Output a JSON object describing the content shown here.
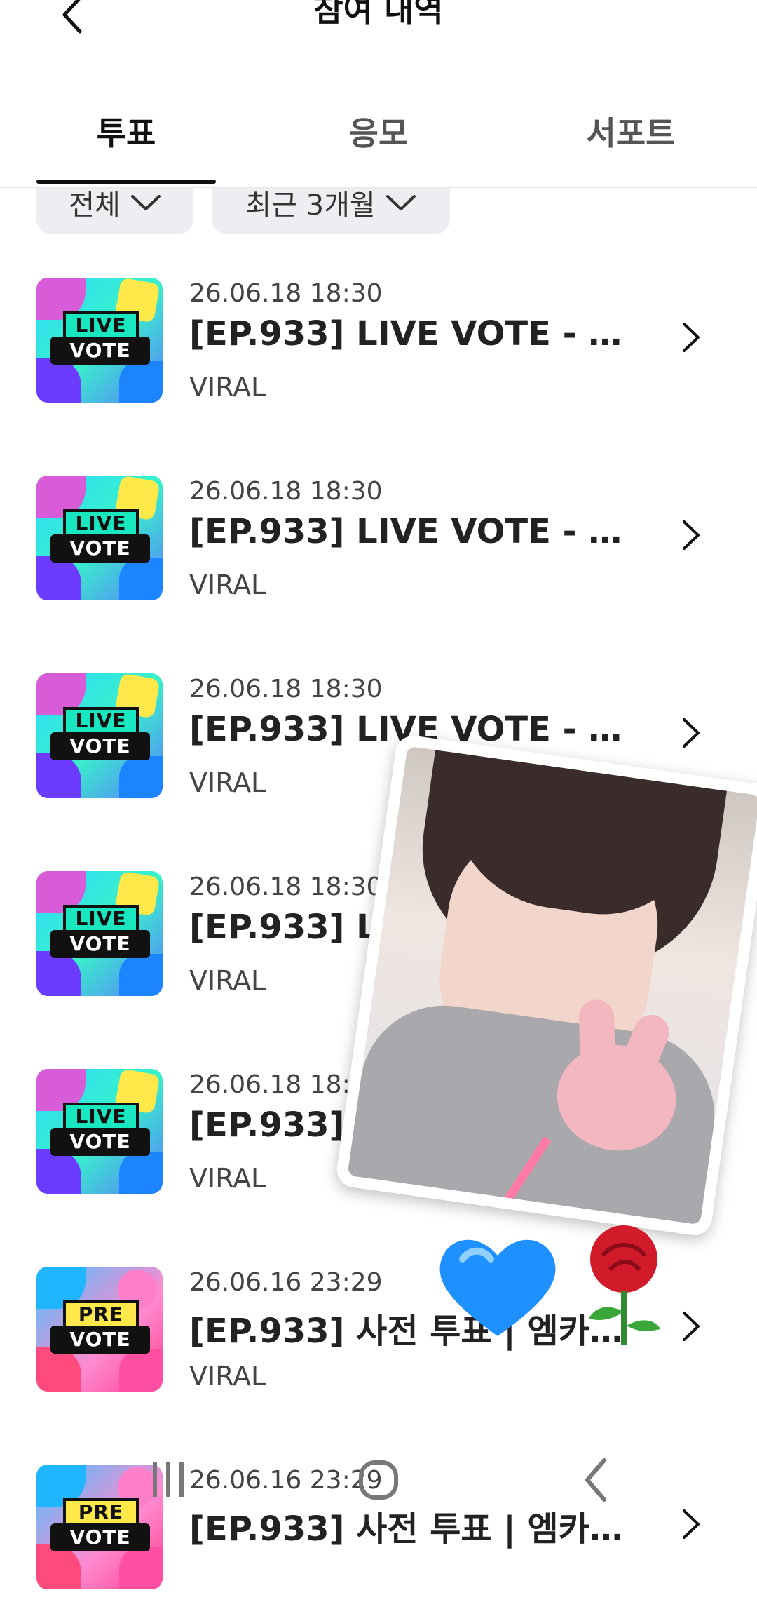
{
  "header": {
    "title": "참여 내역",
    "back_icon": "chevron-left-icon"
  },
  "tabs": [
    {
      "label": "투표",
      "active": true
    },
    {
      "label": "응모",
      "active": false
    },
    {
      "label": "서포트",
      "active": false
    }
  ],
  "filters": [
    {
      "label": "전체"
    },
    {
      "label": "최근 3개월"
    }
  ],
  "items": [
    {
      "date": "26.06.18 18:30",
      "title": "[EP.933] LIVE VOTE - M ...",
      "sub": "VIRAL",
      "thumb": {
        "top": "LIVE",
        "bottom": "VOTE",
        "style": "live"
      }
    },
    {
      "date": "26.06.18 18:30",
      "title": "[EP.933] LIVE VOTE - M ...",
      "sub": "VIRAL",
      "thumb": {
        "top": "LIVE",
        "bottom": "VOTE",
        "style": "live"
      }
    },
    {
      "date": "26.06.18 18:30",
      "title": "[EP.933] LIVE VOTE - M ...",
      "sub": "VIRAL",
      "thumb": {
        "top": "LIVE",
        "bottom": "VOTE",
        "style": "live"
      }
    },
    {
      "date": "26.06.18 18:30",
      "title": "[EP.933] LIVE",
      "sub": "VIRAL",
      "thumb": {
        "top": "LIVE",
        "bottom": "VOTE",
        "style": "live"
      }
    },
    {
      "date": "26.06.18 18:30",
      "title": "[EP.933] L",
      "sub": "VIRAL",
      "thumb": {
        "top": "LIVE",
        "bottom": "VOTE",
        "style": "live"
      }
    },
    {
      "date": "26.06.16 23:29",
      "title": "[EP.933] 사전 투표 | 엠카운...",
      "sub": "VIRAL",
      "thumb": {
        "top": "PRE",
        "bottom": "VOTE",
        "style": "pre"
      }
    },
    {
      "date": "26.06.16 23:29",
      "title": "[EP.933] 사전 투표 | 엠카운...",
      "sub": "",
      "thumb": {
        "top": "PRE",
        "bottom": "VOTE",
        "style": "pre"
      }
    }
  ],
  "colors": {
    "tab_active": "#111111",
    "chip_bg": "#eceef1",
    "heart": "#1e90ff",
    "rose": "#d11a2a"
  },
  "nav_icons": [
    "recent-apps-icon",
    "home-icon",
    "back-icon"
  ]
}
